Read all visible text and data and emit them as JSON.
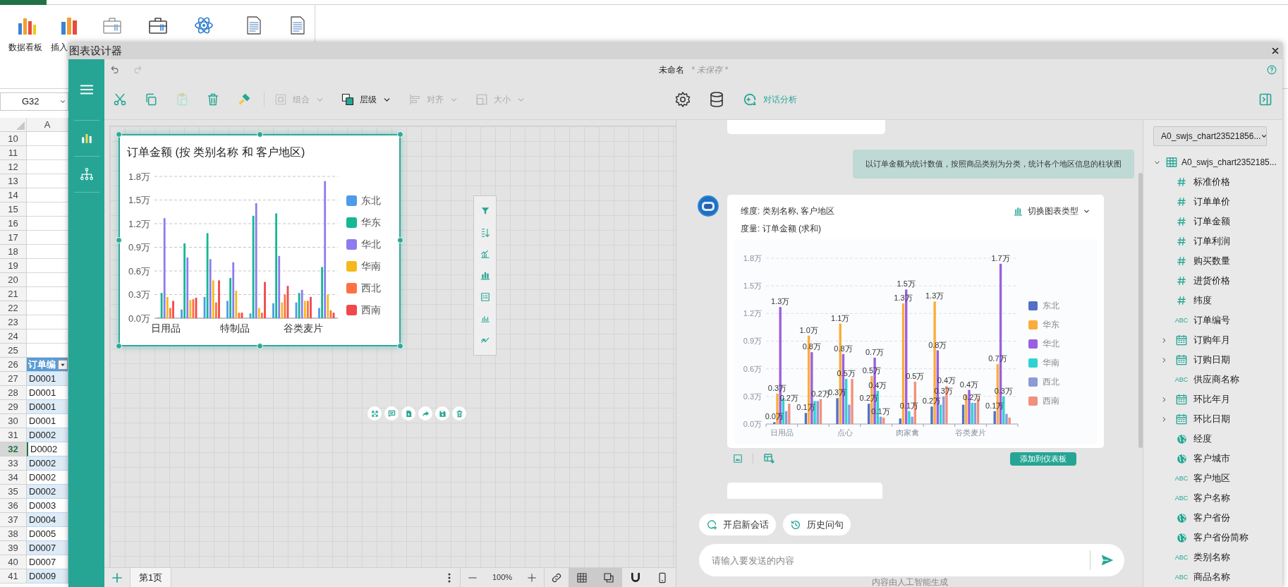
{
  "spreadsheet": {
    "ribbon_labels": [
      "数据看板",
      "插入"
    ],
    "name_box": "G32",
    "column_header": "A",
    "rows": [
      {
        "number": "10",
        "selected": false
      },
      {
        "number": "11",
        "selected": false
      },
      {
        "number": "12",
        "selected": false
      },
      {
        "number": "13",
        "selected": false
      },
      {
        "number": "14",
        "selected": false
      },
      {
        "number": "15",
        "selected": false
      },
      {
        "number": "16",
        "selected": false
      },
      {
        "number": "17",
        "selected": false
      },
      {
        "number": "18",
        "selected": false
      },
      {
        "number": "19",
        "selected": false
      },
      {
        "number": "20",
        "selected": false
      },
      {
        "number": "21",
        "selected": false
      },
      {
        "number": "22",
        "selected": false
      },
      {
        "number": "23",
        "selected": false
      },
      {
        "number": "24",
        "selected": false
      },
      {
        "number": "25",
        "selected": false
      },
      {
        "number": "26",
        "cell": "订单编",
        "kind": "header",
        "selected": false
      },
      {
        "number": "27",
        "cell": "D0001",
        "selected": false
      },
      {
        "number": "28",
        "cell": "D0001",
        "selected": false
      },
      {
        "number": "29",
        "cell": "D0001",
        "selected": false
      },
      {
        "number": "30",
        "cell": "D0001",
        "selected": false
      },
      {
        "number": "31",
        "cell": "D0002",
        "selected": false
      },
      {
        "number": "32",
        "cell": "D0002",
        "selected": true
      },
      {
        "number": "33",
        "cell": "D0002",
        "selected": false
      },
      {
        "number": "34",
        "cell": "D0002",
        "selected": false
      },
      {
        "number": "35",
        "cell": "D0002",
        "selected": false
      },
      {
        "number": "36",
        "cell": "D0003",
        "selected": false
      },
      {
        "number": "37",
        "cell": "D0004",
        "selected": false
      },
      {
        "number": "38",
        "cell": "D0005",
        "selected": false
      },
      {
        "number": "39",
        "cell": "D0007",
        "selected": false
      },
      {
        "number": "40",
        "cell": "D0007",
        "selected": false
      },
      {
        "number": "41",
        "cell": "D0009",
        "selected": false
      }
    ]
  },
  "dialog": {
    "title": "图表设计器",
    "document_name": "未命名",
    "save_status": "* 未保存 *",
    "dropdowns": [
      {
        "label": "组合",
        "kind": "group",
        "disabled": true
      },
      {
        "label": "层级",
        "kind": "layer",
        "disabled": false
      },
      {
        "label": "对齐",
        "kind": "align",
        "disabled": true
      },
      {
        "label": "大小",
        "kind": "size",
        "disabled": true
      }
    ],
    "ai_button": "对话分析"
  },
  "canvas": {
    "chart": {
      "chart_data": {
        "type": "bar",
        "grid": true,
        "legend": true,
        "title": "订单金额 (按 类别名称 和 客户地区)",
        "categories": [
          "日用品",
          null,
          null,
          "特制品",
          null,
          null,
          "谷类麦片",
          null
        ],
        "ylim": [
          0,
          1.8
        ],
        "yticks": [
          {
            "value": 0,
            "label": "0.0万"
          },
          {
            "value": 0.3,
            "label": "0.3万"
          },
          {
            "value": 0.6,
            "label": "0.6万"
          },
          {
            "value": 0.9,
            "label": "0.9万"
          },
          {
            "value": 1.2,
            "label": "1.2万"
          },
          {
            "value": 1.5,
            "label": "1.5万"
          },
          {
            "value": 1.8,
            "label": "1.8万"
          }
        ],
        "series": [
          {
            "name": "东北",
            "color": "#4e9be8",
            "values": [
              0.01,
              0.11,
              0.27,
              0.22,
              0.06,
              0.19,
              0.2,
              0.13
            ]
          },
          {
            "name": "华东",
            "color": "#14b892",
            "values": [
              0.32,
              0.95,
              1.08,
              0.51,
              1.3,
              1.33,
              0.32,
              0.65
            ]
          },
          {
            "name": "华北",
            "color": "#8c7cf0",
            "values": [
              1.27,
              0.77,
              0.75,
              0.71,
              1.46,
              0.79,
              0.36,
              1.74
            ]
          },
          {
            "name": "华南",
            "color": "#f5b91d",
            "values": [
              0.27,
              0.23,
              0.48,
              0.35,
              0.13,
              0.2,
              0.22,
              0.3
            ]
          },
          {
            "name": "西北",
            "color": "#ff7043",
            "values": [
              0.13,
              0.24,
              0.2,
              0.07,
              0.07,
              0.3,
              0.22,
              0.1
            ]
          },
          {
            "name": "西南",
            "color": "#f2484b",
            "values": [
              0.22,
              0.26,
              0.48,
              0.07,
              0.46,
              0.41,
              0.27,
              0.07
            ]
          }
        ]
      }
    }
  },
  "pages": [
    {
      "label": "第1页",
      "selected": true
    }
  ],
  "zoom": "100%",
  "view_toggles": [
    {
      "kind": "grid",
      "selected": true
    },
    {
      "kind": "layers",
      "selected": true
    },
    {
      "kind": "magnet",
      "selected": false
    },
    {
      "kind": "phone",
      "selected": false
    }
  ],
  "chat": {
    "user_message": "以订单金额为统计数值，按照商品类别为分类，统计各个地区信息的柱状图",
    "reply": {
      "dimension": "维度: 类别名称, 客户地区",
      "measure": "度量: 订单金额 (求和)",
      "switch_label": "切换图表类型",
      "chart_data": {
        "type": "bar",
        "grid": true,
        "legend": true,
        "categories": [
          "日用品",
          null,
          "点心",
          null,
          "肉家禽",
          null,
          "谷类麦片",
          null
        ],
        "ylim": [
          0,
          1.8
        ],
        "yticks": [
          {
            "value": 0,
            "label": "0.0万"
          },
          {
            "value": 0.3,
            "label": "0.3万"
          },
          {
            "value": 0.6,
            "label": "0.6万"
          },
          {
            "value": 0.9,
            "label": "0.9万"
          },
          {
            "value": 1.2,
            "label": "1.2万"
          },
          {
            "value": 1.5,
            "label": "1.5万"
          },
          {
            "value": 1.8,
            "label": "1.8万"
          }
        ],
        "series": [
          {
            "name": "东北",
            "color": "#5470c6",
            "values": [
              0.02,
              0.12,
              0.28,
              0.22,
              0.06,
              0.19,
              0.21,
              0.14
            ]
          },
          {
            "name": "华东",
            "color": "#fbad3c",
            "values": [
              0.33,
              0.96,
              1.09,
              0.52,
              1.31,
              1.33,
              0.32,
              0.65
            ]
          },
          {
            "name": "华北",
            "color": "#9a60e0",
            "values": [
              1.27,
              0.78,
              0.76,
              0.72,
              1.46,
              0.8,
              0.37,
              1.74
            ]
          },
          {
            "name": "华南",
            "color": "#2ed3d0",
            "values": [
              0.28,
              0.25,
              0.49,
              0.36,
              0.14,
              0.21,
              0.23,
              0.3
            ]
          },
          {
            "name": "西北",
            "color": "#8d9ad6",
            "values": [
              0.14,
              0.25,
              0.21,
              0.08,
              0.08,
              0.3,
              0.23,
              0.11
            ]
          },
          {
            "name": "西南",
            "color": "#f0917c",
            "values": [
              0.22,
              0.27,
              0.49,
              0.07,
              0.46,
              0.41,
              0.28,
              0.07
            ]
          }
        ],
        "value_labels": [
          [
            "0.0万",
            "0.1万",
            "0.3万",
            "0.2万",
            null,
            "0.2万",
            null,
            "0.1万"
          ],
          [
            "0.3万",
            "1.0万",
            "1.1万",
            "0.5万",
            "1.3万",
            "1.3万",
            null,
            "0.7万"
          ],
          [
            "1.3万",
            "0.8万",
            "0.8万",
            "0.7万",
            "1.5万",
            "0.8万",
            "0.4万",
            "1.7万"
          ],
          [
            null,
            null,
            "0.5万",
            "0.4万",
            "0.1万",
            null,
            "0.2万",
            "0.3万"
          ],
          [
            null,
            null,
            null,
            "0.1万",
            null,
            "0.3万",
            null,
            null
          ],
          [
            "0.2万",
            "0.2万",
            null,
            null,
            "0.5万",
            "0.4万",
            null,
            null
          ]
        ]
      }
    },
    "add_button": "添加到仪表板",
    "actions": [
      {
        "label": "开启新会话",
        "kind": "new"
      },
      {
        "label": "历史问句",
        "kind": "history"
      }
    ],
    "input_placeholder": "请输入要发送的内容",
    "footer": "内容由人工智能生成"
  },
  "fields": {
    "source": "A0_swjs_chart23521856...",
    "table": {
      "label": "A0_swjs_chart2352185...",
      "expanded": true
    },
    "items": [
      {
        "label": "标准价格",
        "kind": "number"
      },
      {
        "label": "订单单价",
        "kind": "number"
      },
      {
        "label": "订单金额",
        "kind": "number"
      },
      {
        "label": "订单利润",
        "kind": "number"
      },
      {
        "label": "购买数量",
        "kind": "number"
      },
      {
        "label": "进货价格",
        "kind": "number"
      },
      {
        "label": "纬度",
        "kind": "number"
      },
      {
        "label": "订单编号",
        "kind": "text",
        "badge": "ABC"
      },
      {
        "label": "订购年月",
        "kind": "date"
      },
      {
        "label": "订购日期",
        "kind": "date"
      },
      {
        "label": "供应商名称",
        "kind": "text",
        "badge": "ABC"
      },
      {
        "label": "环比年月",
        "kind": "date"
      },
      {
        "label": "环比日期",
        "kind": "date"
      },
      {
        "label": "经度",
        "kind": "geo"
      },
      {
        "label": "客户城市",
        "kind": "geo"
      },
      {
        "label": "客户地区",
        "kind": "text",
        "badge": "ABC"
      },
      {
        "label": "客户名称",
        "kind": "text",
        "badge": "ABC"
      },
      {
        "label": "客户省份",
        "kind": "geo"
      },
      {
        "label": "客户省份简称",
        "kind": "geo"
      },
      {
        "label": "类别名称",
        "kind": "text",
        "badge": "ABC"
      },
      {
        "label": "商品名称",
        "kind": "text",
        "badge": "ABC"
      }
    ]
  }
}
